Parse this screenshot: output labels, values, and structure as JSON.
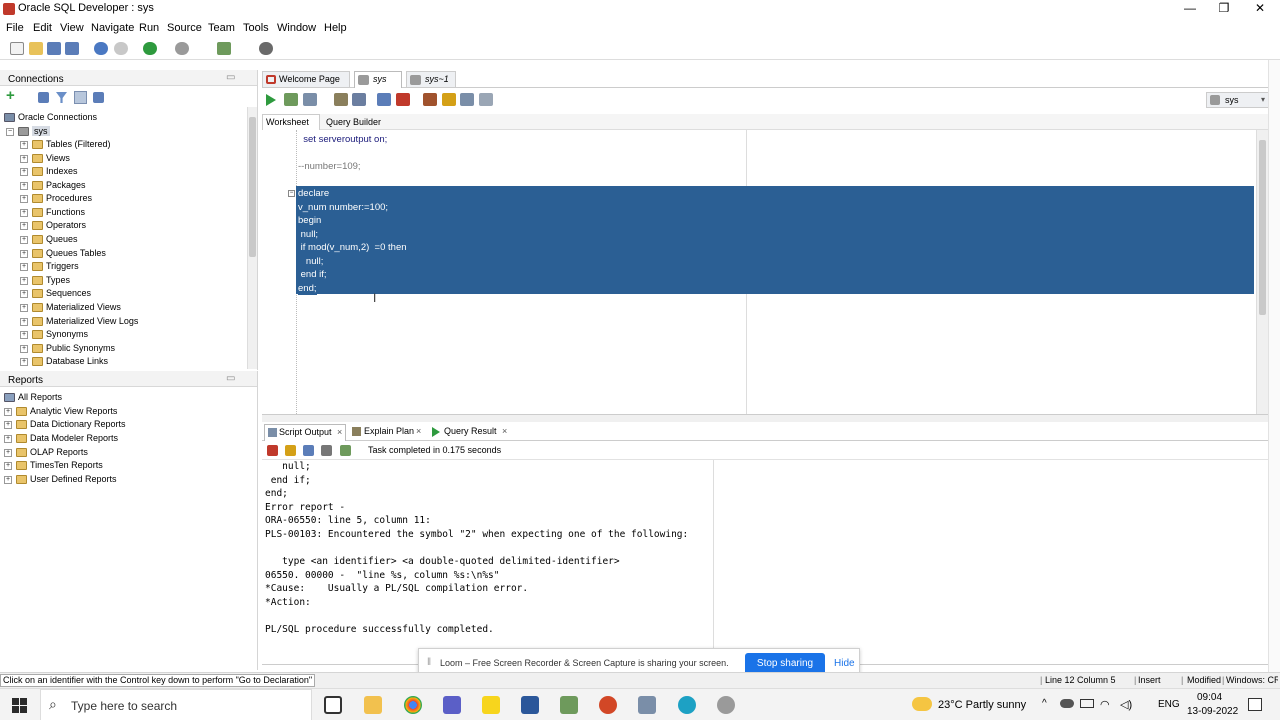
{
  "window": {
    "title": "Oracle SQL Developer : sys",
    "controls": [
      "—",
      "❐",
      "✕"
    ]
  },
  "menu": [
    "File",
    "Edit",
    "View",
    "Navigate",
    "Run",
    "Source",
    "Team",
    "Tools",
    "Window",
    "Help"
  ],
  "connections_panel": {
    "title": "Connections",
    "root": "Oracle Connections",
    "connection": "sys",
    "items": [
      "Tables (Filtered)",
      "Views",
      "Indexes",
      "Packages",
      "Procedures",
      "Functions",
      "Operators",
      "Queues",
      "Queues Tables",
      "Triggers",
      "Types",
      "Sequences",
      "Materialized Views",
      "Materialized View Logs",
      "Synonyms",
      "Public Synonyms",
      "Database Links"
    ]
  },
  "reports_panel": {
    "title": "Reports",
    "root": "All Reports",
    "items": [
      "Analytic View Reports",
      "Data Dictionary Reports",
      "Data Modeler Reports",
      "OLAP Reports",
      "TimesTen Reports",
      "User Defined Reports"
    ]
  },
  "editor_tabs": [
    "Welcome Page",
    "sys",
    "sys~1"
  ],
  "connection_selector": "sys",
  "worksheet_tabs": [
    "Worksheet",
    "Query Builder"
  ],
  "code": {
    "plain": [
      "  set serveroutput on;",
      "",
      "--number=109;",
      ""
    ],
    "selected": [
      "declare",
      "v_num number:=100;",
      "begin",
      " null;",
      " if mod(v_num,2)  =0 then",
      "   null;",
      " end if;",
      "end;"
    ]
  },
  "output_tabs": [
    "Script Output",
    "Explain Plan",
    "Query Result"
  ],
  "output_status": "Task completed in 0.175 seconds",
  "output_lines": [
    "   null;",
    " end if;",
    "end;",
    "Error report -",
    "ORA-06550: line 5, column 11:",
    "PLS-00103: Encountered the symbol \"2\" when expecting one of the following:",
    "",
    "   type <an identifier> <a double-quoted delimited-identifier>",
    "06550. 00000 -  \"line %s, column %s:\\n%s\"",
    "*Cause:    Usually a PL/SQL compilation error.",
    "*Action:",
    "",
    "PL/SQL procedure successfully completed."
  ],
  "loom": {
    "message": "Loom – Free Screen Recorder & Screen Capture is sharing your screen.",
    "stop_label": "Stop sharing",
    "hide_label": "Hide"
  },
  "status": {
    "hint": "Click on an identifier with the Control key down to perform \"Go to Declaration\"",
    "position": "Line 12 Column 5",
    "mode": "Insert",
    "modified": "Modified",
    "platform": "Windows: CR"
  },
  "taskbar": {
    "search_placeholder": "Type here to search",
    "weather": "23°C  Partly sunny",
    "lang": "ENG",
    "time": "09:04",
    "date": "13-09-2022"
  },
  "colors": {
    "selection": "#2b5f94",
    "accent": "#1a73e8",
    "code_text": "#1a1a7a",
    "comment": "#777777"
  }
}
